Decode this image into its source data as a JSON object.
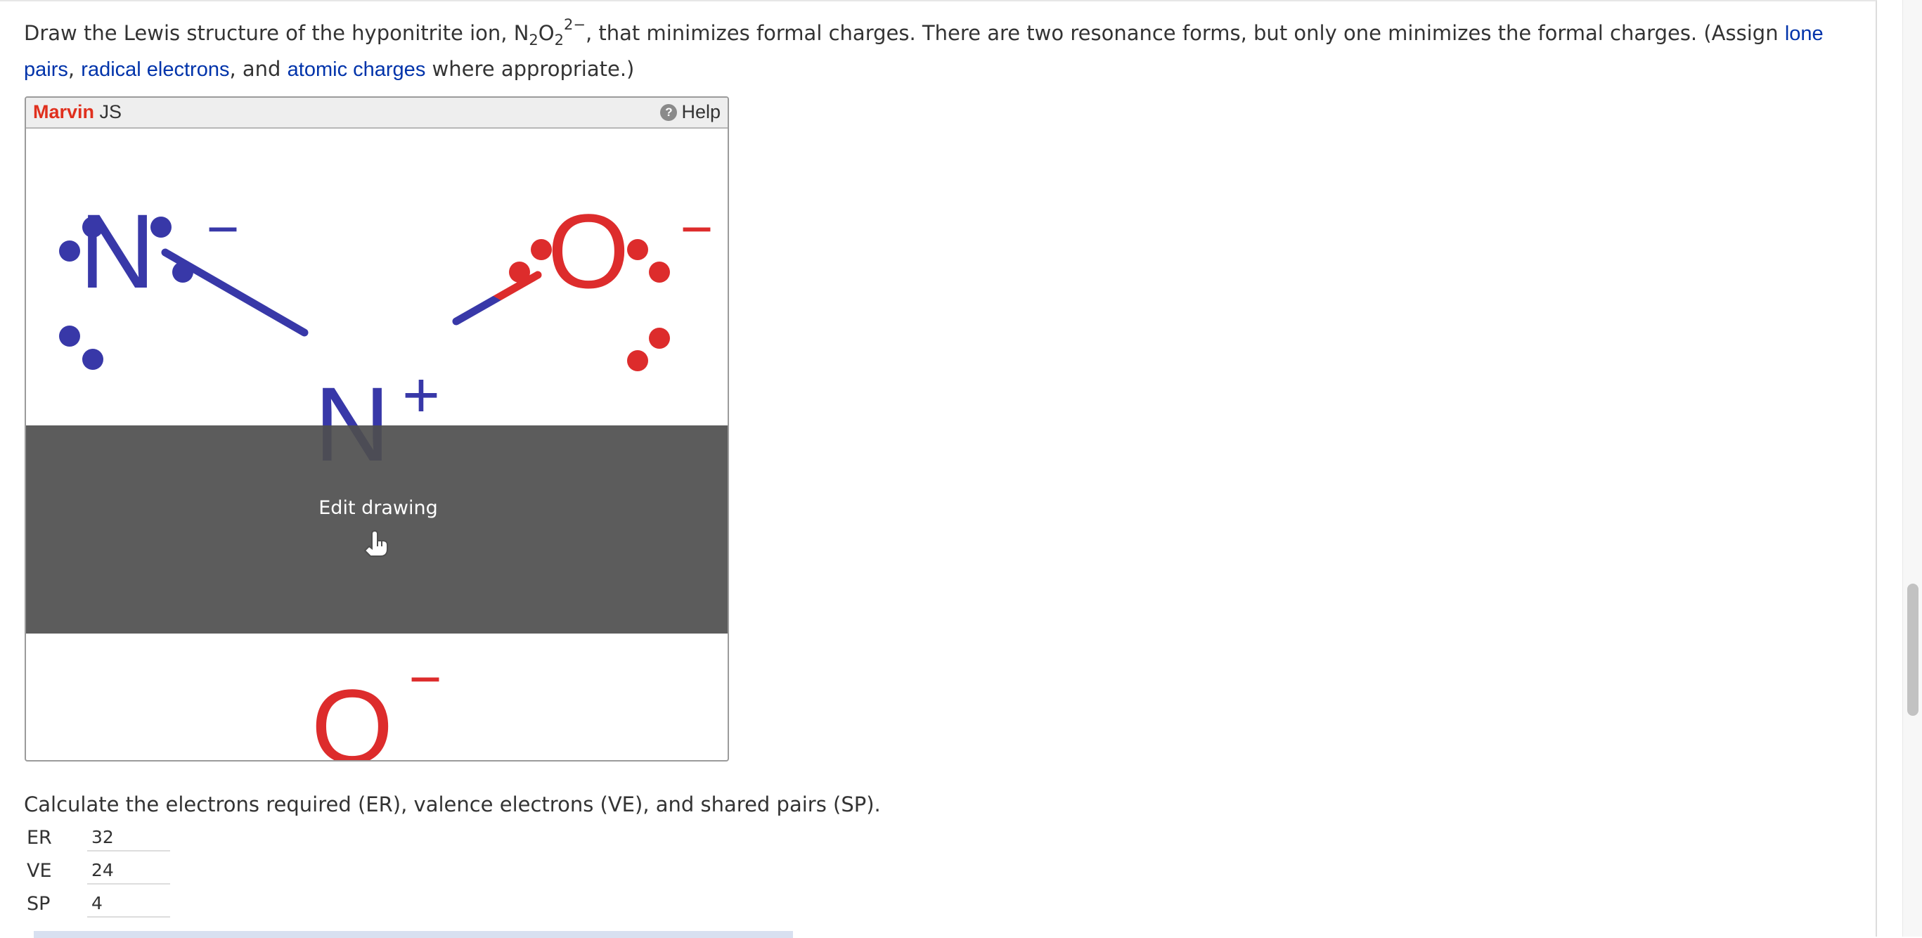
{
  "question": {
    "text_before_formula": "Draw the Lewis structure of the hyponitrite ion, ",
    "formula": {
      "n": "N",
      "n_sub": "2",
      "o": "O",
      "o_sub": "2",
      "charge": "2−"
    },
    "text_after_formula": ", that minimizes formal charges. There are two resonance forms, but only one minimizes the formal charges. (Assign ",
    "link_lone_pairs": "lone pairs",
    "sep1": ", ",
    "link_radical_electrons": "radical electrons",
    "sep2": ", and ",
    "link_atomic_charges": "atomic charges",
    "text_end": " where appropriate.)"
  },
  "marvin": {
    "brand_main": "Marvin",
    "brand_sub": " JS",
    "help_icon_glyph": "?",
    "help_label": "Help",
    "overlay_label": "Edit drawing",
    "molecule": {
      "atom_top_left": "N",
      "atom_center": "N",
      "atom_top_right": "O",
      "atom_bottom": "O",
      "charge_top_left": "−",
      "charge_center": "+",
      "charge_top_right": "−",
      "charge_bottom": "−",
      "colors": {
        "nitrogen": "#3838a8",
        "oxygen": "#dd2c2c"
      }
    }
  },
  "calc": {
    "prompt": "Calculate the electrons required (ER), valence electrons (VE), and shared pairs (SP).",
    "fields": [
      {
        "label": "ER",
        "value": "32"
      },
      {
        "label": "VE",
        "value": "24"
      },
      {
        "label": "SP",
        "value": "4"
      }
    ]
  }
}
